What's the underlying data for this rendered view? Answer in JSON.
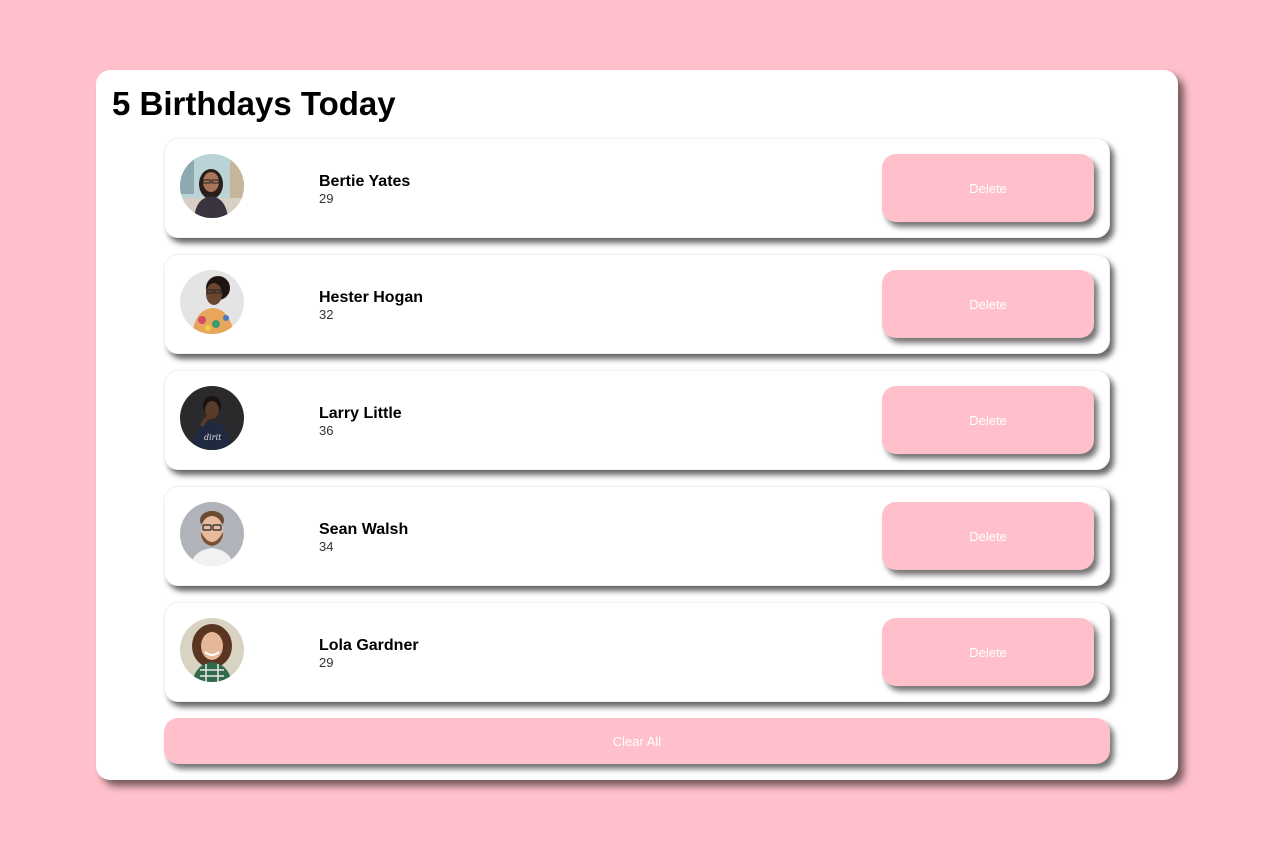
{
  "header": {
    "title": "5 Birthdays Today"
  },
  "people": [
    {
      "name": "Bertie Yates",
      "age": "29",
      "avatar": "woman-glasses-city-photo",
      "delete_label": "Delete"
    },
    {
      "name": "Hester Hogan",
      "age": "32",
      "avatar": "woman-glasses-floral-photo",
      "delete_label": "Delete"
    },
    {
      "name": "Larry Little",
      "age": "36",
      "avatar": "man-dark-tshirt-photo",
      "delete_label": "Delete"
    },
    {
      "name": "Sean Walsh",
      "age": "34",
      "avatar": "man-beard-glasses-photo",
      "delete_label": "Delete"
    },
    {
      "name": "Lola Gardner",
      "age": "29",
      "avatar": "woman-curly-hair-photo",
      "delete_label": "Delete"
    }
  ],
  "footer": {
    "clear_label": "Clear All"
  },
  "colors": {
    "background": "#ffc0cb",
    "button": "#ffc0cb",
    "card": "#ffffff"
  }
}
